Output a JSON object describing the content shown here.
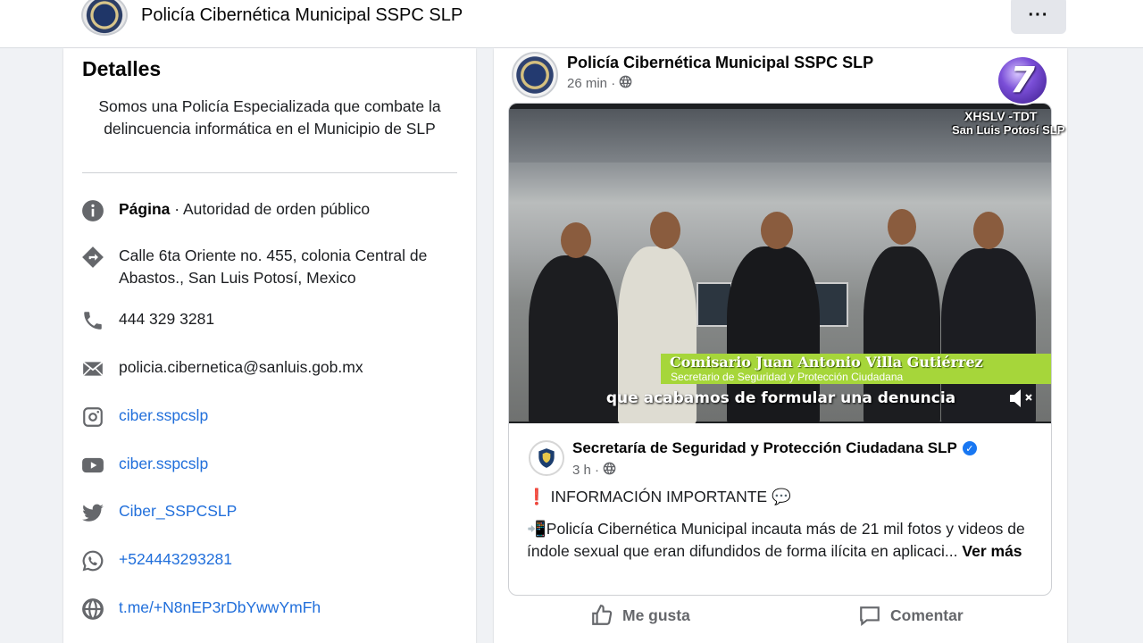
{
  "header": {
    "page_name": "Policía Cibernética Municipal SSPC SLP",
    "more_label": "···"
  },
  "details": {
    "title": "Detalles",
    "description": "Somos una Policía Especializada que combate la delincuencia informática en el Municipio de SLP",
    "category_label": "Página",
    "category_value": " · Autoridad de orden público",
    "address": "Calle 6ta Oriente no. 455, colonia Central de Abastos., San Luis Potosí, Mexico",
    "phone": "444 329 3281",
    "email": "policia.cibernetica@sanluis.gob.mx",
    "instagram": "ciber.sspcslp",
    "youtube": "ciber.sspcslp",
    "twitter": "Ciber_SSPCSLP",
    "whatsapp": "+524443293281",
    "telegram": "t.me/+N8nEP3rDbYwwYmFh"
  },
  "post": {
    "author": "Policía Cibernética Municipal SSPC SLP",
    "time": "26 min ·",
    "video": {
      "lower_third_name": "Comisario Juan Antonio Villa Gutiérrez",
      "lower_third_role": "Secretario de Seguridad y Protección Ciudadana",
      "subtitle": "que acabamos de formular una denuncia"
    },
    "shared": {
      "author": "Secretaría de Seguridad y Protección Ciudadana SLP",
      "time": "3 h ·",
      "headline_mark": "❗",
      "headline": "INFORMACIÓN IMPORTANTE",
      "headline_emoji": "💬",
      "body_emoji": "📲",
      "body": "Policía Cibernética Municipal incauta más de 21 mil fotos y videos de índole sexual que eran difundidos de forma ilícita en aplicaci...",
      "see_more": "Ver más"
    },
    "actions": {
      "like": "Me gusta",
      "comment": "Comentar"
    }
  },
  "watermark": {
    "channel_number": "7",
    "callsign": "XHSLV  -TDT",
    "city": "San Luis Potosí SLP"
  },
  "colors": {
    "link": "#216fdb",
    "background": "#f0f2f5",
    "verified": "#1877f2",
    "lower_third": "#a6d63a"
  }
}
